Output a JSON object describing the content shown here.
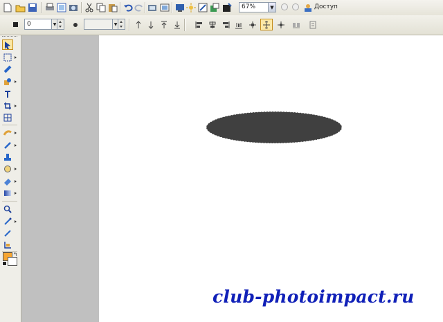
{
  "toolbar": {
    "zoom_value": "67%",
    "access_label": "Доступ",
    "main_buttons": [
      "new-document-icon",
      "open-folder-icon",
      "save-icon",
      "print-icon",
      "scan-icon",
      "camera-icon",
      "cut-icon",
      "copy-icon",
      "paste-icon",
      "undo-icon",
      "redo-icon",
      "image-properties-icon",
      "screen-capture-icon",
      "web-icon",
      "effects-icon",
      "instant-fix-icon",
      "brush-settings-icon",
      "zoom-in-icon",
      "zoom-out-icon",
      "access-user-icon"
    ]
  },
  "options_bar": {
    "spin_value": "0",
    "spin2_value": "",
    "align_buttons": [
      "align-top-icon",
      "align-bottom-icon",
      "bring-to-front-icon",
      "send-to-back-icon",
      "align-left-icon",
      "align-center-icon",
      "align-right-icon",
      "distribute-icon",
      "move-icon",
      "position-icon",
      "anchor-icon",
      "group-icon",
      "properties-icon"
    ]
  },
  "tools": [
    "pick-tool-icon",
    "transform-tool-icon",
    "path-select-icon",
    "selection-tool-icon",
    "text-tool-icon",
    "crop-tool-icon",
    "grid-tool-icon",
    "paint-tool-icon",
    "brush-tool-icon",
    "stamp-tool-icon",
    "clone-tool-icon",
    "eraser-tool-icon",
    "fill-tool-icon",
    "zoom-tool-icon",
    "eyedropper-tool-icon",
    "pen-tool-icon",
    "measure-tool-icon",
    "color-swatch-icon"
  ],
  "colors": {
    "ellipse_fill": "#404040",
    "workspace": "#c0c0c0",
    "watermark": "#1020b8",
    "foreground_swatch": "#f7a632",
    "background_swatch": "#ffffff"
  },
  "canvas": {
    "watermark_text": "club-photoimpact.ru"
  }
}
